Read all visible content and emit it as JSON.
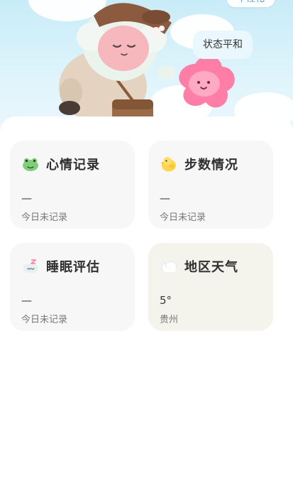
{
  "header": {
    "top_chip": "个性化",
    "speech_bubble": "状态平和"
  },
  "cards": [
    {
      "title": "心情记录",
      "value": "—",
      "sub": "今日未记录",
      "icon": "frog-icon"
    },
    {
      "title": "步数情况",
      "value": "—",
      "sub": "今日未记录",
      "icon": "chick-icon"
    },
    {
      "title": "睡眠评估",
      "value": "—",
      "sub": "今日未记录",
      "icon": "sleep-pillow-icon"
    },
    {
      "title": "地区天气",
      "value": "5°",
      "sub": "贵州",
      "icon": "cloud-icon"
    }
  ],
  "colors": {
    "sky": "#c8ecf8",
    "card_bg": "#f7f7f7",
    "weather_card_bg": "#f4f3ec",
    "accent_blue": "#4aa6d6"
  }
}
